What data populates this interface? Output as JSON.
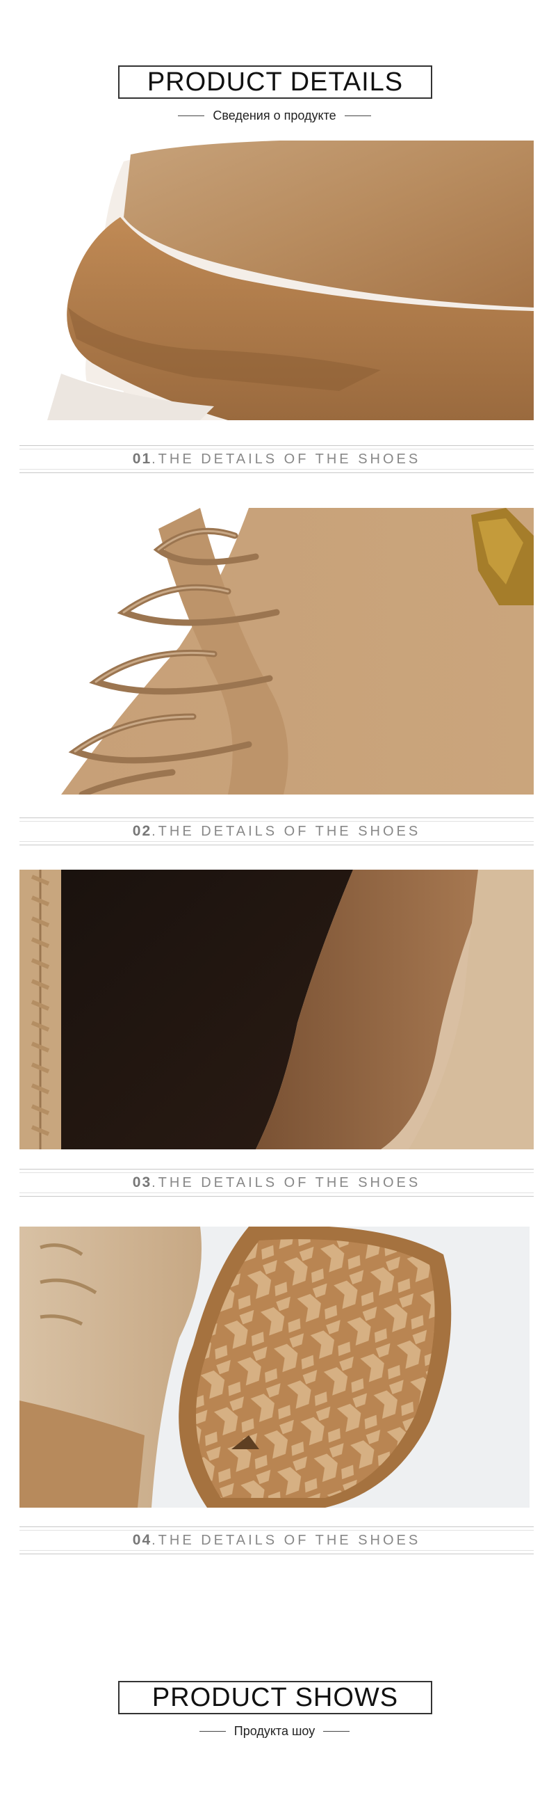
{
  "header": {
    "title": "PRODUCT DETAILS",
    "subtitle": "Сведения о продукте"
  },
  "details": [
    {
      "number": "01",
      "text": ".THE DETAILS OF THE SHOES",
      "image": "boot toe sole closeup"
    },
    {
      "number": "02",
      "text": ".THE DETAILS OF THE SHOES",
      "image": "lace-up suede closeup"
    },
    {
      "number": "03",
      "text": ".THE DETAILS OF THE SHOES",
      "image": "inner lining and zipper"
    },
    {
      "number": "04",
      "text": ".THE DETAILS OF THE SHOES",
      "image": "rubber outsole tread"
    }
  ],
  "footer_section": {
    "title": "PRODUCT SHOWS",
    "subtitle": "Продукта шоу"
  },
  "colors": {
    "suede": "#c49a6c",
    "suede_dark": "#a87a4f",
    "sole": "#b07a47",
    "lining": "#1e140f",
    "caption_number": "#777777",
    "caption_text": "#888888"
  }
}
